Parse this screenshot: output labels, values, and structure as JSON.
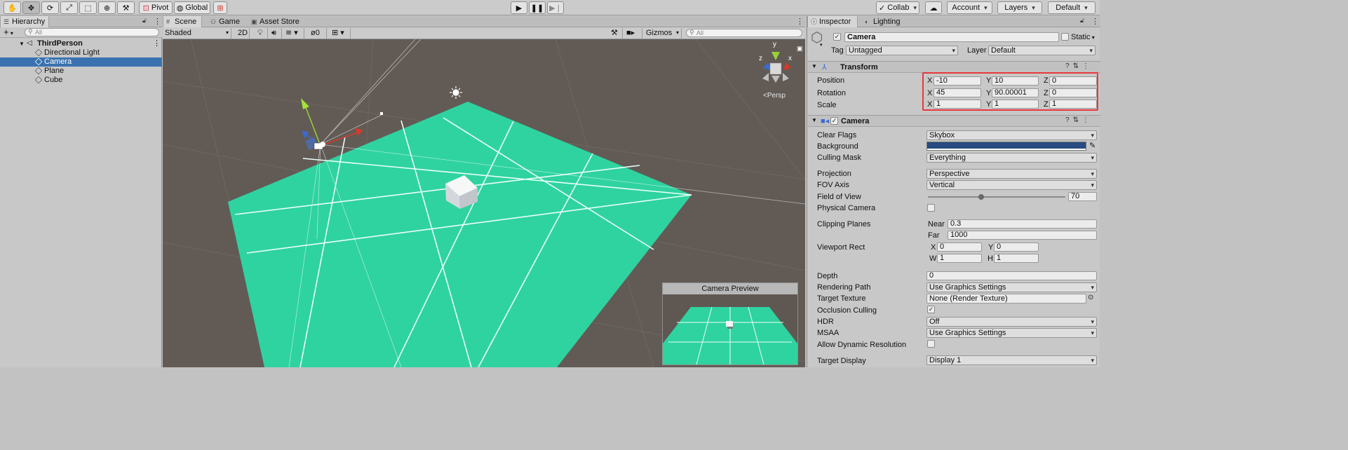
{
  "toolbar": {
    "pivot": "Pivot",
    "global": "Global",
    "collab": "Collab",
    "account": "Account",
    "layers": "Layers",
    "layout": "Default"
  },
  "hierarchy": {
    "tab": "Hierarchy",
    "add": "+",
    "search_placeholder": "All",
    "scene_name": "ThirdPerson",
    "items": [
      {
        "label": "Directional Light"
      },
      {
        "label": "Camera"
      },
      {
        "label": "Plane"
      },
      {
        "label": "Cube"
      }
    ]
  },
  "scene_view": {
    "tabs": [
      "Scene",
      "Game",
      "Asset Store"
    ],
    "shading": "Shaded",
    "mode_2d": "2D",
    "hidden_count": "0",
    "gizmos": "Gizmos",
    "search_placeholder": "All",
    "projection_label": "Persp",
    "axis_labels": {
      "x": "x",
      "y": "y",
      "z": "z"
    },
    "camera_preview_title": "Camera Preview",
    "plane_color": "#2fd3a0",
    "background_color": "#625b55"
  },
  "inspector": {
    "tabs": [
      "Inspector",
      "Lighting"
    ],
    "object_name": "Camera",
    "static_label": "Static",
    "tag_label": "Tag",
    "tag_value": "Untagged",
    "layer_label": "Layer",
    "layer_value": "Default",
    "transform": {
      "title": "Transform",
      "position_label": "Position",
      "rotation_label": "Rotation",
      "scale_label": "Scale",
      "axis_x": "X",
      "axis_y": "Y",
      "axis_z": "Z",
      "position": {
        "x": "-10",
        "y": "10",
        "z": "0"
      },
      "rotation": {
        "x": "45",
        "y": "90.00001",
        "z": "0"
      },
      "scale": {
        "x": "1",
        "y": "1",
        "z": "1"
      },
      "highlight_color": "#e8383d"
    },
    "camera": {
      "title": "Camera",
      "clear_flags_label": "Clear Flags",
      "clear_flags": "Skybox",
      "background_label": "Background",
      "background_color": "#274a80",
      "culling_mask_label": "Culling Mask",
      "culling_mask": "Everything",
      "projection_label": "Projection",
      "projection": "Perspective",
      "fov_axis_label": "FOV Axis",
      "fov_axis": "Vertical",
      "fov_label": "Field of View",
      "fov_value": "70",
      "fov_fraction": 0.39,
      "physical_camera_label": "Physical Camera",
      "clipping_label": "Clipping Planes",
      "near_label": "Near",
      "near": "0.3",
      "far_label": "Far",
      "far": "1000",
      "viewport_label": "Viewport Rect",
      "vp_x_label": "X",
      "vp_x": "0",
      "vp_y_label": "Y",
      "vp_y": "0",
      "vp_w_label": "W",
      "vp_w": "1",
      "vp_h_label": "H",
      "vp_h": "1",
      "depth_label": "Depth",
      "depth": "0",
      "rendering_path_label": "Rendering Path",
      "rendering_path": "Use Graphics Settings",
      "target_texture_label": "Target Texture",
      "target_texture": "None (Render Texture)",
      "occlusion_label": "Occlusion Culling",
      "hdr_label": "HDR",
      "hdr": "Off",
      "msaa_label": "MSAA",
      "msaa": "Use Graphics Settings",
      "dynamic_res_label": "Allow Dynamic Resolution",
      "target_display_label": "Target Display",
      "target_display": "Display 1"
    }
  }
}
